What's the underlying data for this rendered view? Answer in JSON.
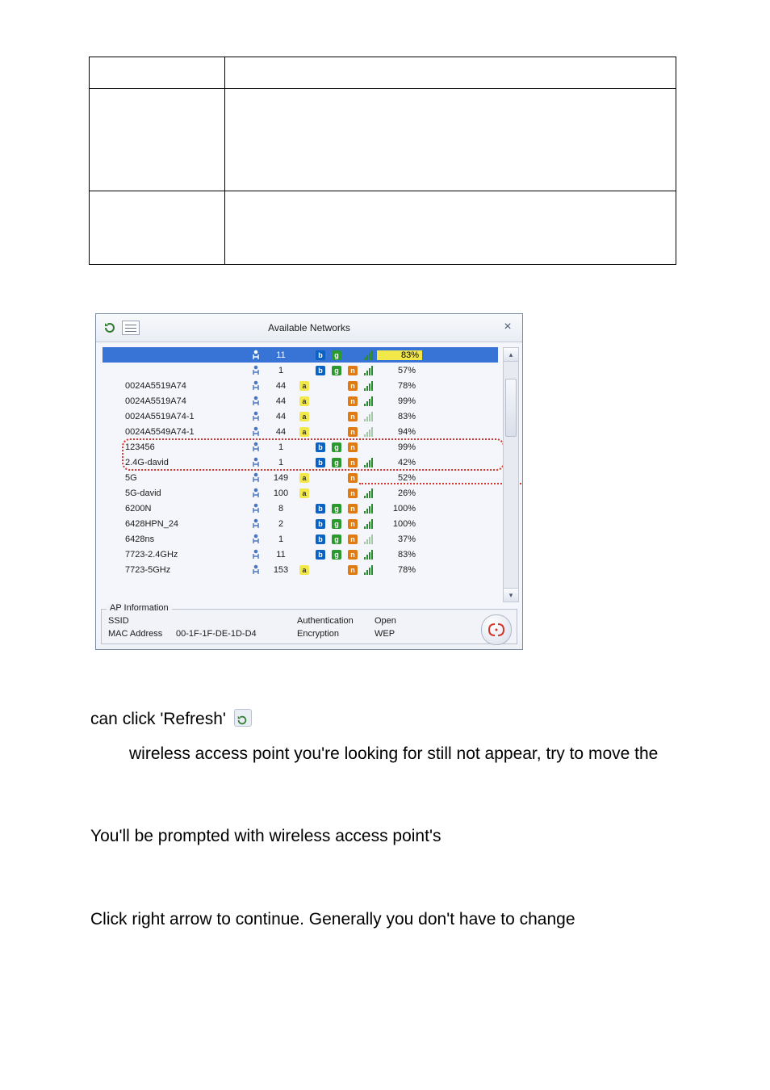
{
  "panel": {
    "title": "Available Networks",
    "close": "×"
  },
  "networks": [
    {
      "ssid": "",
      "chan": "11",
      "a": "",
      "b": "b",
      "g": "g",
      "n": "",
      "sig": "s",
      "pct": "83%",
      "sel": true
    },
    {
      "ssid": "",
      "chan": "1",
      "a": "",
      "b": "b",
      "g": "g",
      "n": "n",
      "sig": "s",
      "pct": "57%"
    },
    {
      "ssid": "0024A5519A74",
      "chan": "44",
      "a": "a",
      "b": "",
      "g": "",
      "n": "n",
      "sig": "s",
      "pct": "78%"
    },
    {
      "ssid": "0024A5519A74",
      "chan": "44",
      "a": "a",
      "b": "",
      "g": "",
      "n": "n",
      "sig": "s",
      "pct": "99%"
    },
    {
      "ssid": "0024A5519A74-1",
      "chan": "44",
      "a": "a",
      "b": "",
      "g": "",
      "n": "n",
      "sig": "w",
      "pct": "83%"
    },
    {
      "ssid": "0024A5549A74-1",
      "chan": "44",
      "a": "a",
      "b": "",
      "g": "",
      "n": "n",
      "sig": "w",
      "pct": "94%"
    },
    {
      "ssid": "123456",
      "chan": "1",
      "a": "",
      "b": "b",
      "g": "g",
      "n": "n",
      "sig": "",
      "pct": "99%"
    },
    {
      "ssid": "2.4G-david",
      "chan": "1",
      "a": "",
      "b": "b",
      "g": "g",
      "n": "n",
      "sig": "s",
      "pct": "42%"
    },
    {
      "ssid": "5G",
      "chan": "149",
      "a": "a",
      "b": "",
      "g": "",
      "n": "n",
      "sig": "",
      "pct": "52%"
    },
    {
      "ssid": "5G-david",
      "chan": "100",
      "a": "a",
      "b": "",
      "g": "",
      "n": "n",
      "sig": "s",
      "pct": "26%"
    },
    {
      "ssid": "6200N",
      "chan": "8",
      "a": "",
      "b": "b",
      "g": "g",
      "n": "n",
      "sig": "s",
      "pct": "100%"
    },
    {
      "ssid": "6428HPN_24",
      "chan": "2",
      "a": "",
      "b": "b",
      "g": "g",
      "n": "n",
      "sig": "s",
      "pct": "100%"
    },
    {
      "ssid": "6428ns",
      "chan": "1",
      "a": "",
      "b": "b",
      "g": "g",
      "n": "n",
      "sig": "w",
      "pct": "37%"
    },
    {
      "ssid": "7723-2.4GHz",
      "chan": "11",
      "a": "",
      "b": "b",
      "g": "g",
      "n": "n",
      "sig": "s",
      "pct": "83%"
    },
    {
      "ssid": "7723-5GHz",
      "chan": "153",
      "a": "a",
      "b": "",
      "g": "",
      "n": "n",
      "sig": "s",
      "pct": "78%"
    }
  ],
  "ap": {
    "legend": "AP Information",
    "ssid_label": "SSID",
    "ssid_value": "",
    "auth_label": "Authentication",
    "auth_value": "Open",
    "mac_label": "MAC Address",
    "mac_value": "00-1F-1F-DE-1D-D4",
    "enc_label": "Encryption",
    "enc_value": "WEP",
    "arrow": "(( ))"
  },
  "text": {
    "l1": "can click 'Refresh'",
    "l2": "wireless access point you're looking for still not appear, try to move the",
    "l3": "You'll be prompted with wireless access point's",
    "l4": "Click right arrow to continue. Generally you don't have to change"
  }
}
